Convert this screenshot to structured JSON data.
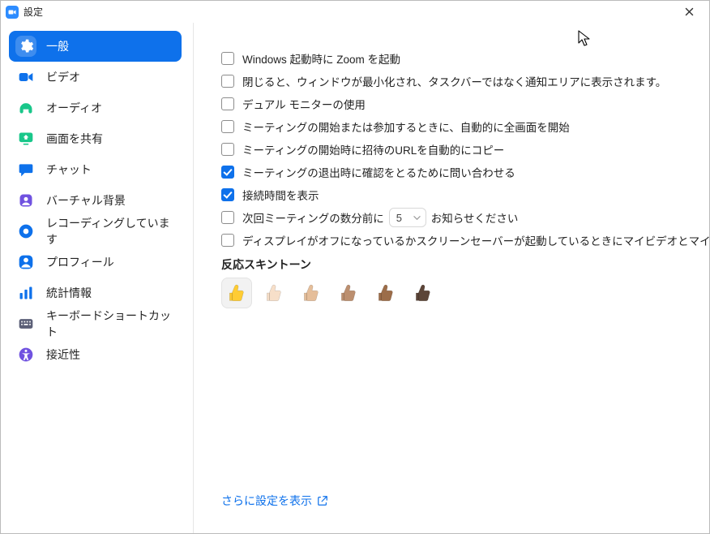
{
  "window": {
    "title": "設定"
  },
  "sidebar": {
    "items": [
      {
        "key": "general",
        "label": "一般",
        "active": true,
        "color": "#ffffff"
      },
      {
        "key": "video",
        "label": "ビデオ",
        "active": false,
        "color": "#0E71EB"
      },
      {
        "key": "audio",
        "label": "オーディオ",
        "active": false,
        "color": "#19c78a"
      },
      {
        "key": "share",
        "label": "画面を共有",
        "active": false,
        "color": "#19c78a"
      },
      {
        "key": "chat",
        "label": "チャット",
        "active": false,
        "color": "#0E71EB"
      },
      {
        "key": "vb",
        "label": "バーチャル背景",
        "active": false,
        "color": "#7052e0"
      },
      {
        "key": "record",
        "label": "レコーディングしています",
        "active": false,
        "color": "#0E71EB"
      },
      {
        "key": "profile",
        "label": "プロフィール",
        "active": false,
        "color": "#0E71EB"
      },
      {
        "key": "stats",
        "label": "統計情報",
        "active": false,
        "color": "#0E71EB"
      },
      {
        "key": "shortcuts",
        "label": "キーボードショートカット",
        "active": false,
        "color": "#5b5f77"
      },
      {
        "key": "access",
        "label": "接近性",
        "active": false,
        "color": "#7052e0"
      }
    ]
  },
  "options": {
    "o0": {
      "label": "Windows 起動時に Zoom を起動",
      "checked": false
    },
    "o1": {
      "label": "閉じると、ウィンドウが最小化され、タスクバーではなく通知エリアに表示されます。",
      "checked": false
    },
    "o2": {
      "label": "デュアル モニターの使用",
      "checked": false
    },
    "o3": {
      "label": "ミーティングの開始または参加するときに、自動的に全画面を開始",
      "checked": false
    },
    "o4": {
      "label": "ミーティングの開始時に招待のURLを自動的にコピー",
      "checked": false
    },
    "o5": {
      "label": "ミーティングの退出時に確認をとるために問い合わせる",
      "checked": true
    },
    "o6": {
      "label": "接続時間を表示",
      "checked": true
    },
    "o7_prefix": "次回ミーティングの数分前に",
    "o7_value": "5",
    "o7_suffix": "お知らせください",
    "o7_checked": false,
    "o8": {
      "label": "ディスプレイがオフになっているかスクリーンセーバーが起動しているときにマイビデオとマイオーディ…",
      "checked": false
    }
  },
  "skintone": {
    "title": "反応スキントーン",
    "selected": 0,
    "colors": [
      "#FFCC33",
      "#F7DFC9",
      "#E5BE9A",
      "#BC8F6F",
      "#9C6D49",
      "#5C4538"
    ]
  },
  "footer": {
    "more_settings": "さらに設定を表示"
  }
}
